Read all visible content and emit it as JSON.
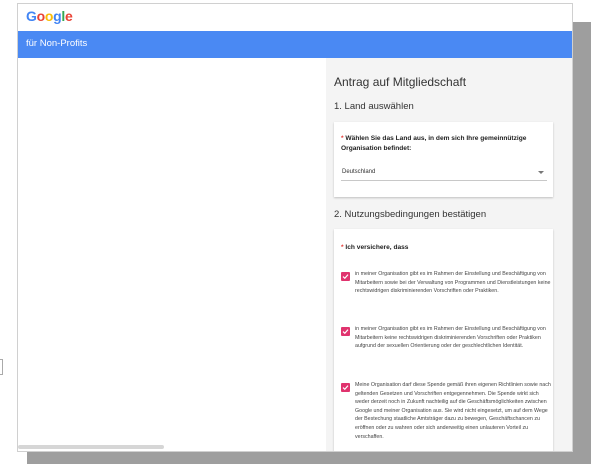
{
  "header": {
    "logo_text": "Google",
    "logo_letters": [
      "G",
      "o",
      "o",
      "g",
      "l",
      "e"
    ],
    "logo_colors": [
      "#4285F4",
      "#EA4335",
      "#FBBC05",
      "#4285F4",
      "#34A853",
      "#EA4335"
    ],
    "bar_title": "für Non-Profits",
    "bar_color": "#4A89F3"
  },
  "form": {
    "title": "Antrag auf Mitgliedschaft",
    "section1_title": "1. Land auswählen",
    "country_required_mark": "*",
    "country_label": "Wählen Sie das Land aus, in dem sich Ihre gemeinnützige Organisation befindet:",
    "country_value": "Deutschland",
    "section2_title": "2. Nutzungsbedingungen bestätigen",
    "assure_required_mark": "*",
    "assure_label": "Ich versichere, dass",
    "options": [
      {
        "checked": true,
        "text": "in meiner Organisation gibt es im Rahmen der Einstellung und Beschäftigung von Mitarbeitern sowie bei der Verwaltung von Programmen und Dienstleistungen keine rechtswidrigen diskriminierenden Vorschriften oder Praktiken."
      },
      {
        "checked": true,
        "text": "in meiner Organisation gibt es im Rahmen der Einstellung und Beschäftigung von Mitarbeitern keine rechtswidrigen diskriminierenden Vorschriften oder Praktiken aufgrund der sexuellen Orientierung oder der geschlechtlichen Identität."
      },
      {
        "checked": true,
        "text": "Meine Organisation darf diese Spende gemäß ihren eigenen Richtlinien sowie nach geltenden Gesetzen und Vorschriften entgegennehmen. Die Spende wirkt sich weder derzeit noch in Zukunft nachteilig auf die Geschäftsmöglichkeiten zwischen Google und meiner Organisation aus. Sie wird nicht eingesetzt, um auf dem Wege der Bestechung staatliche Amtsträger dazu zu bewegen, Geschäftschancen zu eröffnen oder zu wahren oder sich anderweitig einen unlauteren Vorteil zu verschaffen."
      }
    ],
    "checkbox_color": "#E0336E"
  }
}
